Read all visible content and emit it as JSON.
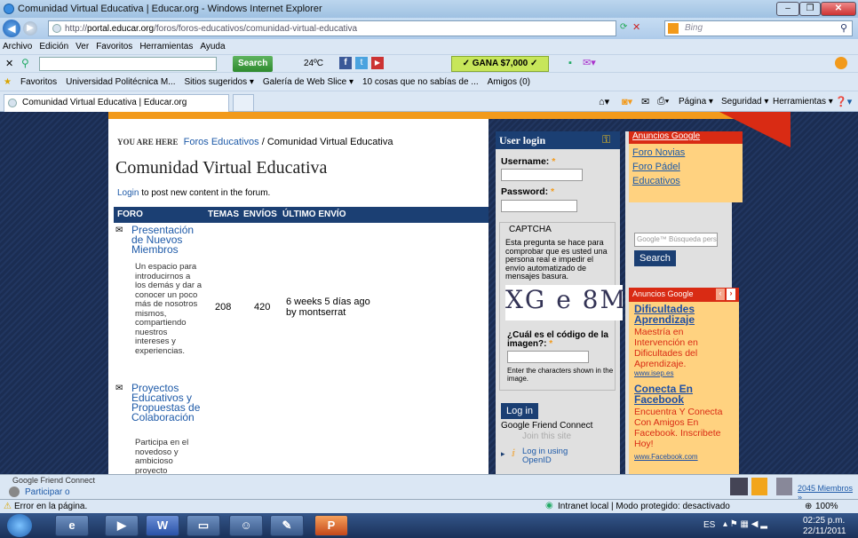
{
  "window": {
    "title": "Comunidad Virtual Educativa | Educar.org - Windows Internet Explorer"
  },
  "address": {
    "url_prefix": "http://",
    "url_domain": "portal.educar.org",
    "url_path": "/foros/foros-educativos/comunidad-virtual-educativa",
    "search_placeholder": "Bing"
  },
  "menu": [
    "Archivo",
    "Edición",
    "Ver",
    "Favoritos",
    "Herramientas",
    "Ayuda"
  ],
  "toolbar": {
    "search_button": "Search",
    "temp": "24ºC",
    "promo": "✓ GANA $7,000 ✓"
  },
  "favorites": {
    "label": "Favoritos",
    "items": [
      "Universidad Politécnica M...",
      "Sitios sugeridos ▾",
      "Galería de Web Slice ▾",
      "10 cosas que no sabías de ...",
      "Amigos (0)"
    ]
  },
  "tab": {
    "title": "Comunidad Virtual Educativa | Educar.org",
    "tools": [
      "Página ▾",
      "Seguridad ▾",
      "Herramientas ▾"
    ]
  },
  "page": {
    "breadcrumb_label": "YOU ARE HERE",
    "breadcrumb_link": "Foros Educativos",
    "breadcrumb_sep": "/",
    "breadcrumb_current": "Comunidad Virtual Educativa",
    "title": "Comunidad Virtual Educativa",
    "login_link": "Login",
    "login_text": "to post new content in the forum.",
    "table_headers": [
      "FORO",
      "TEMAS",
      "ENVÍOS",
      "ÚLTIMO ENVÍO"
    ],
    "forums": [
      {
        "name": "Presentación de Nuevos Miembros",
        "desc": "Un espacio para introducirnos a los demás y dar a conocer un poco más de nosotros mismos, compartiendo nuestros intereses y experiencias.",
        "topics": "208",
        "posts": "420",
        "last_time": "6 weeks 5 días ago",
        "last_by": "by montserrat"
      },
      {
        "name": "Proyectos Educativos y Propuestas de Colaboración",
        "desc": "Participa en el novedoso y ambicioso proyecto",
        "topics": "",
        "posts": "",
        "last_time": "",
        "last_by": ""
      }
    ]
  },
  "login": {
    "title": "User login",
    "username_label": "Username:",
    "password_label": "Password:",
    "captcha_title": "CAPTCHA",
    "captcha_text": "Esta pregunta se hace para comprobar que es usted una persona real e impedir el envío automatizado de mensajes basura.",
    "captcha_image_text": "XG e 8M",
    "captcha_question": "¿Cuál es el código de la imagen?:",
    "captcha_hint": "Enter the characters shown in the image.",
    "login_button": "Log in",
    "gfc_title": "Google Friend Connect",
    "gfc_join": "Join this site",
    "openid": "Log in using OpenID"
  },
  "ads": {
    "header": "Anuncios Google",
    "links": [
      "Foro Novias",
      "Foro Pádel",
      "Educativos"
    ],
    "search_placeholder": "Google™ Búsqueda perso",
    "search_button": "Search",
    "box_header": "Anuncios Google",
    "entries": [
      {
        "title": "Dificultades Aprendizaje",
        "text": "Maestría en Intervención en Dificultades del Aprendizaje.",
        "url": "www.isep.es"
      },
      {
        "title": "Conecta En Facebook",
        "text": "Encuentra Y Conecta Con Amigos En Facebook. Inscribete Hoy!",
        "url": "www.Facebook.com"
      }
    ]
  },
  "gfc_bar": {
    "title": "Google Friend Connect",
    "join": "Participar o",
    "members": "2045 Miembros »"
  },
  "status": {
    "left": "Error en la página.",
    "zone": "Intranet local | Modo protegido: desactivado",
    "zoom": "100%"
  },
  "taskbar": {
    "lang": "ES",
    "time": "02:25 p.m.",
    "date": "22/11/2011"
  }
}
